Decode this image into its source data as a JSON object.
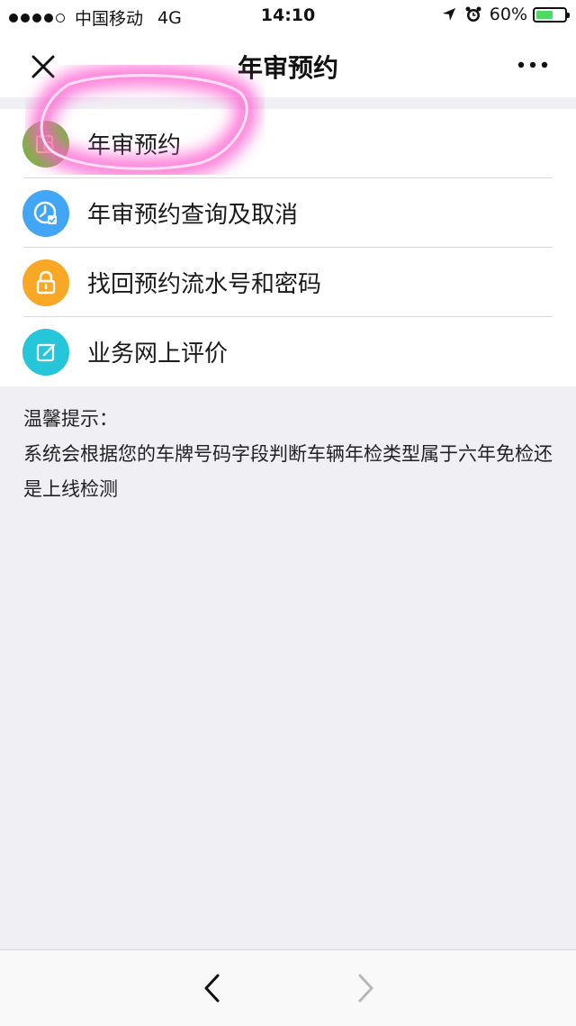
{
  "status_bar": {
    "carrier": "中国移动",
    "network": "4G",
    "time": "14:10",
    "battery": "60%",
    "battery_level": 0.6,
    "signal_bars": 4,
    "signal_total": 5
  },
  "nav": {
    "title": "年审预约",
    "close_icon": "close-icon",
    "more_icon": "more-icon"
  },
  "menu": {
    "items": [
      {
        "label": "年审预约",
        "icon": "calendar-search-icon",
        "color": "#7cb342"
      },
      {
        "label": "年审预约查询及取消",
        "icon": "clock-icon",
        "color": "#42a5f5"
      },
      {
        "label": "找回预约流水号和密码",
        "icon": "lock-icon",
        "color": "#f9a825"
      },
      {
        "label": "业务网上评价",
        "icon": "edit-icon",
        "color": "#26c6da"
      }
    ]
  },
  "tips": {
    "heading": "温馨提示：",
    "body": "系统会根据您的车牌号码字段判断车辆年检类型属于六年免检还是上线检测"
  },
  "colors": {
    "highlight": "#ff5fd0",
    "background": "#efeff4",
    "battery": "#4cd964"
  }
}
